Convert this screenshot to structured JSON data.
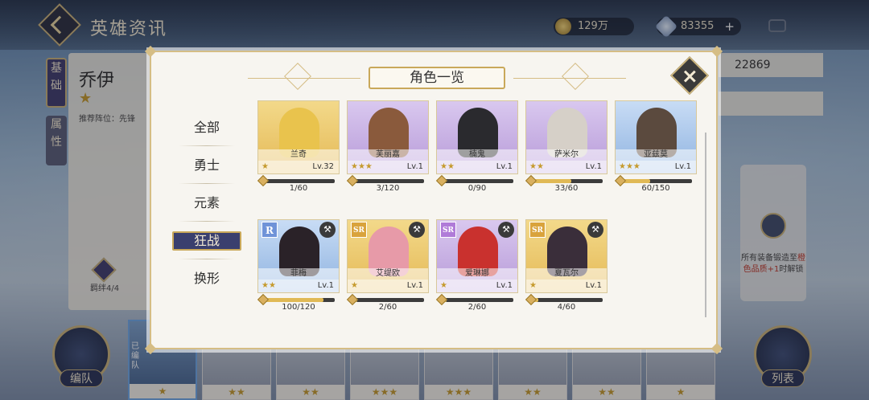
{
  "header": {
    "title": "英雄资讯",
    "gold": "129万",
    "gems": "83355",
    "gems_plus": "+"
  },
  "side_tabs": {
    "basic": "基础",
    "attr": "属性"
  },
  "hero": {
    "name": "乔伊",
    "star": "★",
    "position_text": "推荐阵位：先锋",
    "bond_text": "羁绊4/4"
  },
  "right_panel": {
    "value": "22869"
  },
  "lock_panel": {
    "text_before": "所有装备锻造至",
    "text_highlight": "橙色品质+1",
    "text_after": "时解锁"
  },
  "bottom": {
    "team_label": "编队",
    "list_label": "列表",
    "deployed_label": "已编队",
    "cards": [
      {
        "stars": "★",
        "deployed": true
      },
      {
        "stars": "★★",
        "deployed": false
      },
      {
        "stars": "★★",
        "deployed": false
      },
      {
        "stars": "★★★",
        "deployed": false
      },
      {
        "stars": "★★★",
        "deployed": false
      },
      {
        "stars": "★★",
        "deployed": false
      },
      {
        "stars": "★★",
        "deployed": false
      },
      {
        "stars": "★",
        "deployed": false
      }
    ]
  },
  "modal": {
    "title": "角色一览",
    "filters": [
      "全部",
      "勇士",
      "元素",
      "狂战",
      "换形"
    ],
    "active_filter_index": 3,
    "heroes": [
      {
        "name": "兰奇",
        "stars": "★",
        "level": "Lv.32",
        "shards": "1/60",
        "shard_fraction": 0.017,
        "frame": "gold",
        "portrait_color": "#e9c34d",
        "rarity": "",
        "role_icon": ""
      },
      {
        "name": "芙丽嘉",
        "stars": "★★★",
        "level": "Lv.1",
        "shards": "3/120",
        "shard_fraction": 0.025,
        "frame": "purple",
        "portrait_color": "#8a5a3c",
        "rarity": "",
        "role_icon": ""
      },
      {
        "name": "楠鬼",
        "stars": "★★",
        "level": "Lv.1",
        "shards": "0/90",
        "shard_fraction": 0.0,
        "frame": "purple",
        "portrait_color": "#2a2a2e",
        "rarity": "",
        "role_icon": ""
      },
      {
        "name": "萨米尔",
        "stars": "★★",
        "level": "Lv.1",
        "shards": "33/60",
        "shard_fraction": 0.55,
        "frame": "purple",
        "portrait_color": "#d6d0c8",
        "rarity": "",
        "role_icon": ""
      },
      {
        "name": "亚兹莫",
        "stars": "★★★",
        "level": "Lv.1",
        "shards": "60/150",
        "shard_fraction": 0.4,
        "frame": "blue",
        "portrait_color": "#5b4a3e",
        "rarity": "",
        "role_icon": ""
      },
      {
        "name": "菲梅",
        "stars": "★★",
        "level": "Lv.1",
        "shards": "100/120",
        "shard_fraction": 0.833,
        "frame": "blue",
        "portrait_color": "#2a2228",
        "rarity": "R",
        "role_icon": "axe-icon"
      },
      {
        "name": "艾缇欧",
        "stars": "★",
        "level": "Lv.1",
        "shards": "2/60",
        "shard_fraction": 0.033,
        "frame": "gold",
        "portrait_color": "#e79aa8",
        "rarity": "SR",
        "role_icon": "axe-icon"
      },
      {
        "name": "爱琳娜",
        "stars": "★",
        "level": "Lv.1",
        "shards": "2/60",
        "shard_fraction": 0.033,
        "frame": "purple",
        "portrait_color": "#c9312e",
        "rarity": "SR",
        "role_icon": "axe-icon"
      },
      {
        "name": "夏瓦尔",
        "stars": "★",
        "level": "Lv.1",
        "shards": "4/60",
        "shard_fraction": 0.067,
        "frame": "gold",
        "portrait_color": "#3a2e3a",
        "rarity": "SR",
        "role_icon": "axe-icon"
      }
    ]
  },
  "colors": {
    "accent_gold": "#c9b27a",
    "active_pill": "#3a3f6e",
    "shard_fill": "#e0b955"
  }
}
